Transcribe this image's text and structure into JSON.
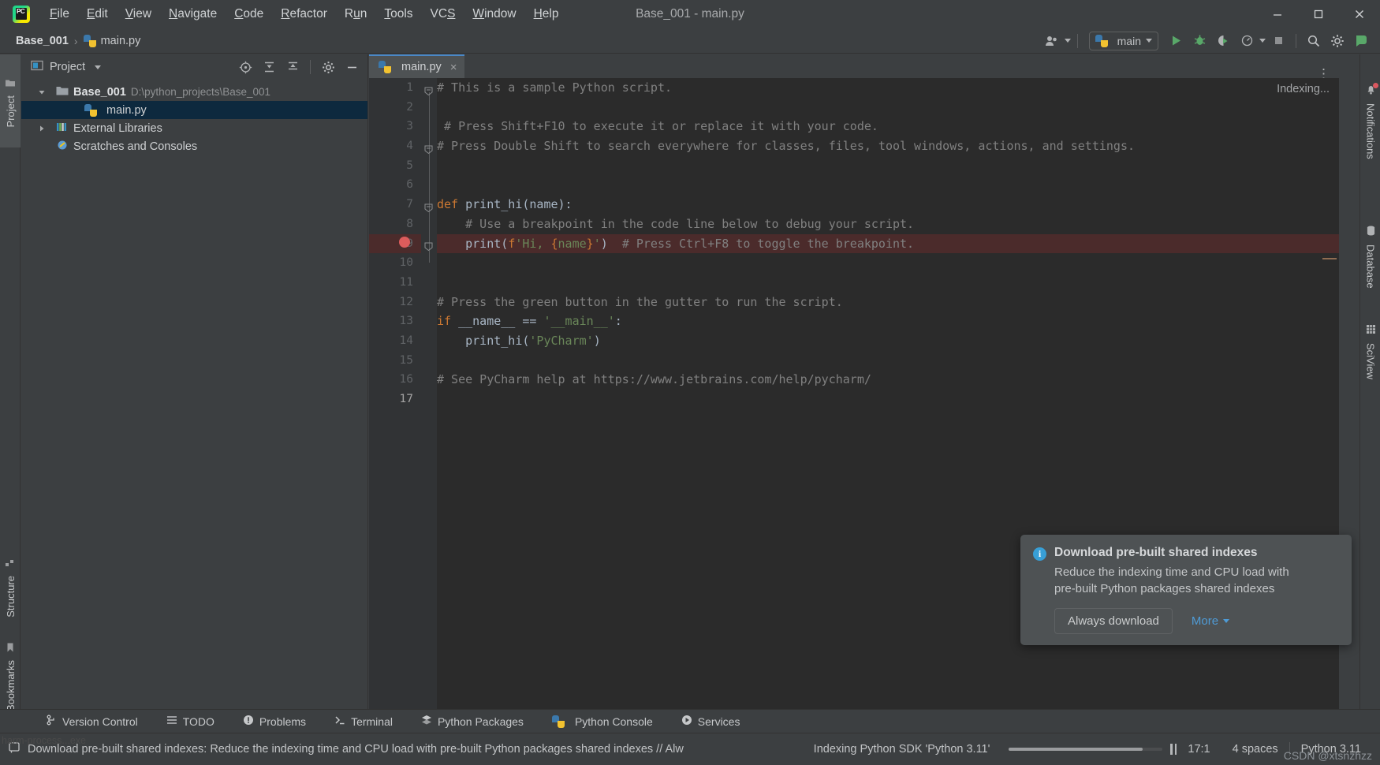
{
  "window": {
    "title": "Base_001 - main.py",
    "controls": [
      "minimize",
      "maximize",
      "close"
    ]
  },
  "menubar": {
    "items": [
      {
        "label": "File",
        "mnemonic": "F"
      },
      {
        "label": "Edit",
        "mnemonic": "E"
      },
      {
        "label": "View",
        "mnemonic": "V"
      },
      {
        "label": "Navigate",
        "mnemonic": "N"
      },
      {
        "label": "Code",
        "mnemonic": "C"
      },
      {
        "label": "Refactor",
        "mnemonic": "R"
      },
      {
        "label": "Run",
        "mnemonic": "u"
      },
      {
        "label": "Tools",
        "mnemonic": "T"
      },
      {
        "label": "VCS",
        "mnemonic": "S"
      },
      {
        "label": "Window",
        "mnemonic": "W"
      },
      {
        "label": "Help",
        "mnemonic": "H"
      }
    ]
  },
  "navbar": {
    "breadcrumb": [
      {
        "label": "Base_001",
        "icon": "project-icon"
      },
      {
        "label": "main.py",
        "icon": "python-file-icon"
      }
    ],
    "separator": "›",
    "run_config": {
      "label": "main",
      "icon": "python-icon",
      "caret": "chevron-down-icon"
    },
    "actions": [
      {
        "name": "settings-sync-icon"
      },
      {
        "name": "run-icon"
      },
      {
        "name": "debug-icon"
      },
      {
        "name": "run-coverage-icon"
      },
      {
        "name": "profile-icon"
      },
      {
        "name": "stop-icon"
      },
      {
        "name": "search-icon"
      },
      {
        "name": "settings-icon"
      },
      {
        "name": "ai-assistant-icon"
      }
    ]
  },
  "left_strip": {
    "top": [
      {
        "label": "Project",
        "icon": "project-folder-icon",
        "active": true
      }
    ],
    "bottom": [
      {
        "label": "Structure",
        "icon": "structure-icon"
      },
      {
        "label": "Bookmarks",
        "icon": "bookmark-icon"
      }
    ]
  },
  "right_strip": {
    "items": [
      {
        "label": "Notifications",
        "icon": "bell-icon",
        "badge": true
      },
      {
        "label": "Database",
        "icon": "database-icon"
      },
      {
        "label": "SciView",
        "icon": "sciview-icon"
      }
    ]
  },
  "project_panel": {
    "title": "Project",
    "title_caret": "chevron-down-icon",
    "actions": [
      {
        "name": "select-opened-file-icon"
      },
      {
        "name": "expand-all-icon"
      },
      {
        "name": "collapse-all-icon"
      },
      {
        "name": "gear-icon"
      },
      {
        "name": "hide-icon"
      }
    ],
    "tree": [
      {
        "label": "Base_001",
        "path": "D:\\python_projects\\Base_001",
        "icon": "folder-icon",
        "expanded": true,
        "bold": true,
        "indent": 1
      },
      {
        "label": "main.py",
        "path": "",
        "icon": "python-file-icon",
        "selected": true,
        "indent": 2
      },
      {
        "label": "External Libraries",
        "path": "",
        "icon": "libraries-icon",
        "expanded": false,
        "indent": 1
      },
      {
        "label": "Scratches and Consoles",
        "path": "",
        "icon": "scratches-icon",
        "indent": 1
      }
    ]
  },
  "editor": {
    "tabs": [
      {
        "label": "main.py",
        "icon": "python-file-icon",
        "active": true,
        "close": "×"
      }
    ],
    "indexing_label": "Indexing...",
    "breakpoint_line": 9,
    "lines": [
      {
        "n": 1,
        "text": "# This is a sample Python script."
      },
      {
        "n": 2,
        "text": ""
      },
      {
        "n": 3,
        "text": " # Press Shift+F10 to execute it or replace it with your code."
      },
      {
        "n": 4,
        "text": "# Press Double Shift to search everywhere for classes, files, tool windows, actions, and settings."
      },
      {
        "n": 5,
        "text": ""
      },
      {
        "n": 6,
        "text": ""
      },
      {
        "n": 7,
        "text": "def print_hi(name):"
      },
      {
        "n": 8,
        "text": "    # Use a breakpoint in the code line below to debug your script."
      },
      {
        "n": 9,
        "text": "    print(f'Hi, {name}')  # Press Ctrl+F8 to toggle the breakpoint."
      },
      {
        "n": 10,
        "text": ""
      },
      {
        "n": 11,
        "text": ""
      },
      {
        "n": 12,
        "text": "# Press the green button in the gutter to run the script."
      },
      {
        "n": 13,
        "text": "if __name__ == '__main__':"
      },
      {
        "n": 14,
        "text": "    print_hi('PyCharm')"
      },
      {
        "n": 15,
        "text": ""
      },
      {
        "n": 16,
        "text": "# See PyCharm help at https://www.jetbrains.com/help/pycharm/"
      },
      {
        "n": 17,
        "text": ""
      }
    ]
  },
  "notification": {
    "icon": "info-icon",
    "title": "Download pre-built shared indexes",
    "body_line1": "Reduce the indexing time and CPU load with",
    "body_line2": "pre-built Python packages shared indexes",
    "primary_button": "Always download",
    "more_link": "More",
    "more_caret": "chevron-down-icon"
  },
  "bottom_bar": {
    "items": [
      {
        "label": "Version Control",
        "icon": "branch-icon"
      },
      {
        "label": "TODO",
        "icon": "todo-icon"
      },
      {
        "label": "Problems",
        "icon": "problems-icon"
      },
      {
        "label": "Terminal",
        "icon": "terminal-icon"
      },
      {
        "label": "Python Packages",
        "icon": "packages-icon"
      },
      {
        "label": "Python Console",
        "icon": "python-icon"
      },
      {
        "label": "Services",
        "icon": "services-icon"
      }
    ]
  },
  "status_bar": {
    "message_icon": "balloon-icon",
    "message": "Download pre-built shared indexes: Reduce the indexing time and CPU load with pre-built Python packages shared indexes // Alw",
    "progress_text": "Indexing Python SDK 'Python 3.11'",
    "progress_percent": 87,
    "pause_icon": "pause-icon",
    "caret_position": "17:1",
    "indent": "4 spaces",
    "interpreter": "Python 3.11",
    "watermark": "CSDN @xtsnzhzz"
  },
  "taskbar": {
    "text": "harm-process...exe"
  },
  "colors": {
    "accent_blue": "#4a88c7",
    "selection": "#0d293e",
    "breakpoint_red": "#db5c5c",
    "breakpoint_line_bg": "#4b2b2b",
    "keyword_orange": "#cc7832",
    "string_green": "#6a8759",
    "comment_gray": "#808080",
    "link_blue": "#4e9bd6",
    "info_blue": "#389fd6",
    "editor_bg": "#2b2b2b",
    "panel_bg": "#3c3f41"
  }
}
